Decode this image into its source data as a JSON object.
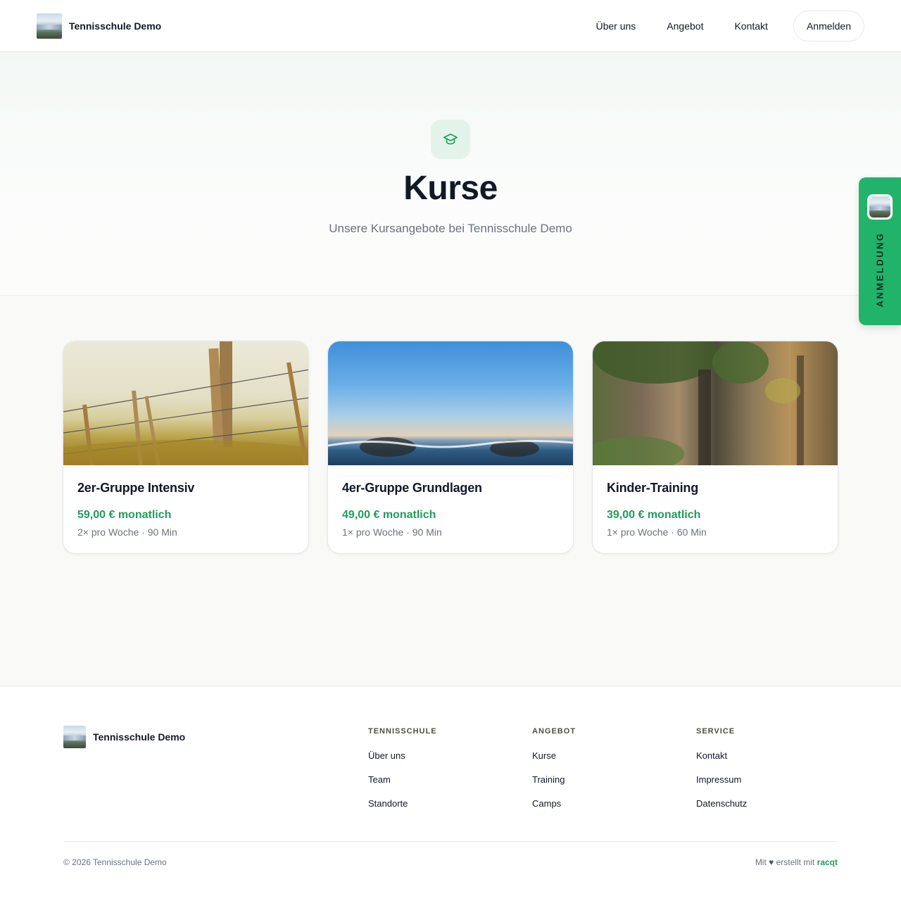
{
  "header": {
    "brand_name": "Tennisschule Demo",
    "nav": [
      "Über uns",
      "Angebot",
      "Kontakt"
    ],
    "login_label": "Anmelden"
  },
  "hero": {
    "icon": "graduation-cap-icon",
    "title": "Kurse",
    "subtitle": "Unsere Kursangebote bei Tennisschule Demo"
  },
  "courses": [
    {
      "title": "2er-Gruppe Intensiv",
      "price": "59,00 € monatlich",
      "meta": "2× pro Woche · 90 Min",
      "image": "fence-photo"
    },
    {
      "title": "4er-Gruppe Grundlagen",
      "price": "49,00 € monatlich",
      "meta": "1× pro Woche · 90 Min",
      "image": "sea-photo"
    },
    {
      "title": "Kinder-Training",
      "price": "39,00 € monatlich",
      "meta": "1× pro Woche · 60 Min",
      "image": "rocks-photo"
    }
  ],
  "side_tab": {
    "label": "ANMELDUNG"
  },
  "footer": {
    "brand_name": "Tennisschule Demo",
    "columns": [
      {
        "heading": "TENNISSCHULE",
        "links": [
          "Über uns",
          "Team",
          "Standorte"
        ]
      },
      {
        "heading": "ANGEBOT",
        "links": [
          "Kurse",
          "Training",
          "Camps"
        ]
      },
      {
        "heading": "SERVICE",
        "links": [
          "Kontakt",
          "Impressum",
          "Datenschutz"
        ]
      }
    ],
    "copyright": "© 2026 Tennisschule Demo",
    "made_prefix": "Mit",
    "made_middle": "erstellt mit",
    "made_brand": "racqt"
  },
  "colors": {
    "accent": "#1f9d5a",
    "side_tab": "#22b36b",
    "hero_icon_bg": "#e3f3ea"
  }
}
